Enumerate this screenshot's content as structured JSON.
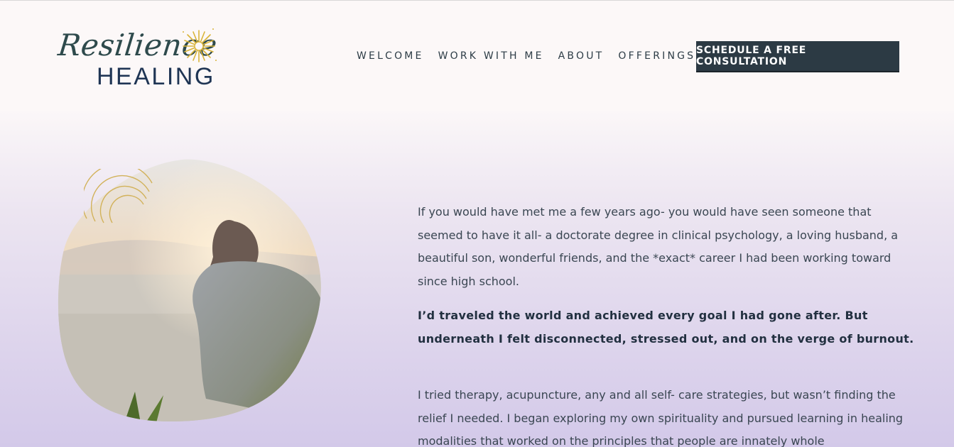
{
  "brand": {
    "script_text": "Resilience",
    "word_text": "HEALING",
    "accent_color": "#d9b43a",
    "navy_color": "#1f3554"
  },
  "nav": {
    "items": [
      {
        "label": "WELCOME"
      },
      {
        "label": "WORK WITH ME"
      },
      {
        "label": "ABOUT"
      },
      {
        "label": "OFFERINGS"
      }
    ],
    "cta_label": "SCHEDULE A FREE CONSULTATION",
    "cta_color": "#2c3a44"
  },
  "hero": {
    "paragraph_1": " If you would have met me a few years ago- you would have seen someone that seemed to have it all- a doctorate degree in clinical psychology, a loving husband, a beautiful son, wonderful friends, and the *exact* career I had been working toward since high school.",
    "paragraph_2": "I’d traveled the world and achieved every goal I had gone after.  But underneath I felt disconnected, stressed out, and on the verge of burnout.",
    "paragraph_3": "I tried therapy, acupuncture, any and all self- care strategies, but wasn’t finding the relief I needed.  I began exploring my own spirituality and pursued learning in healing modalities that worked on the principles that people are innately whole"
  }
}
